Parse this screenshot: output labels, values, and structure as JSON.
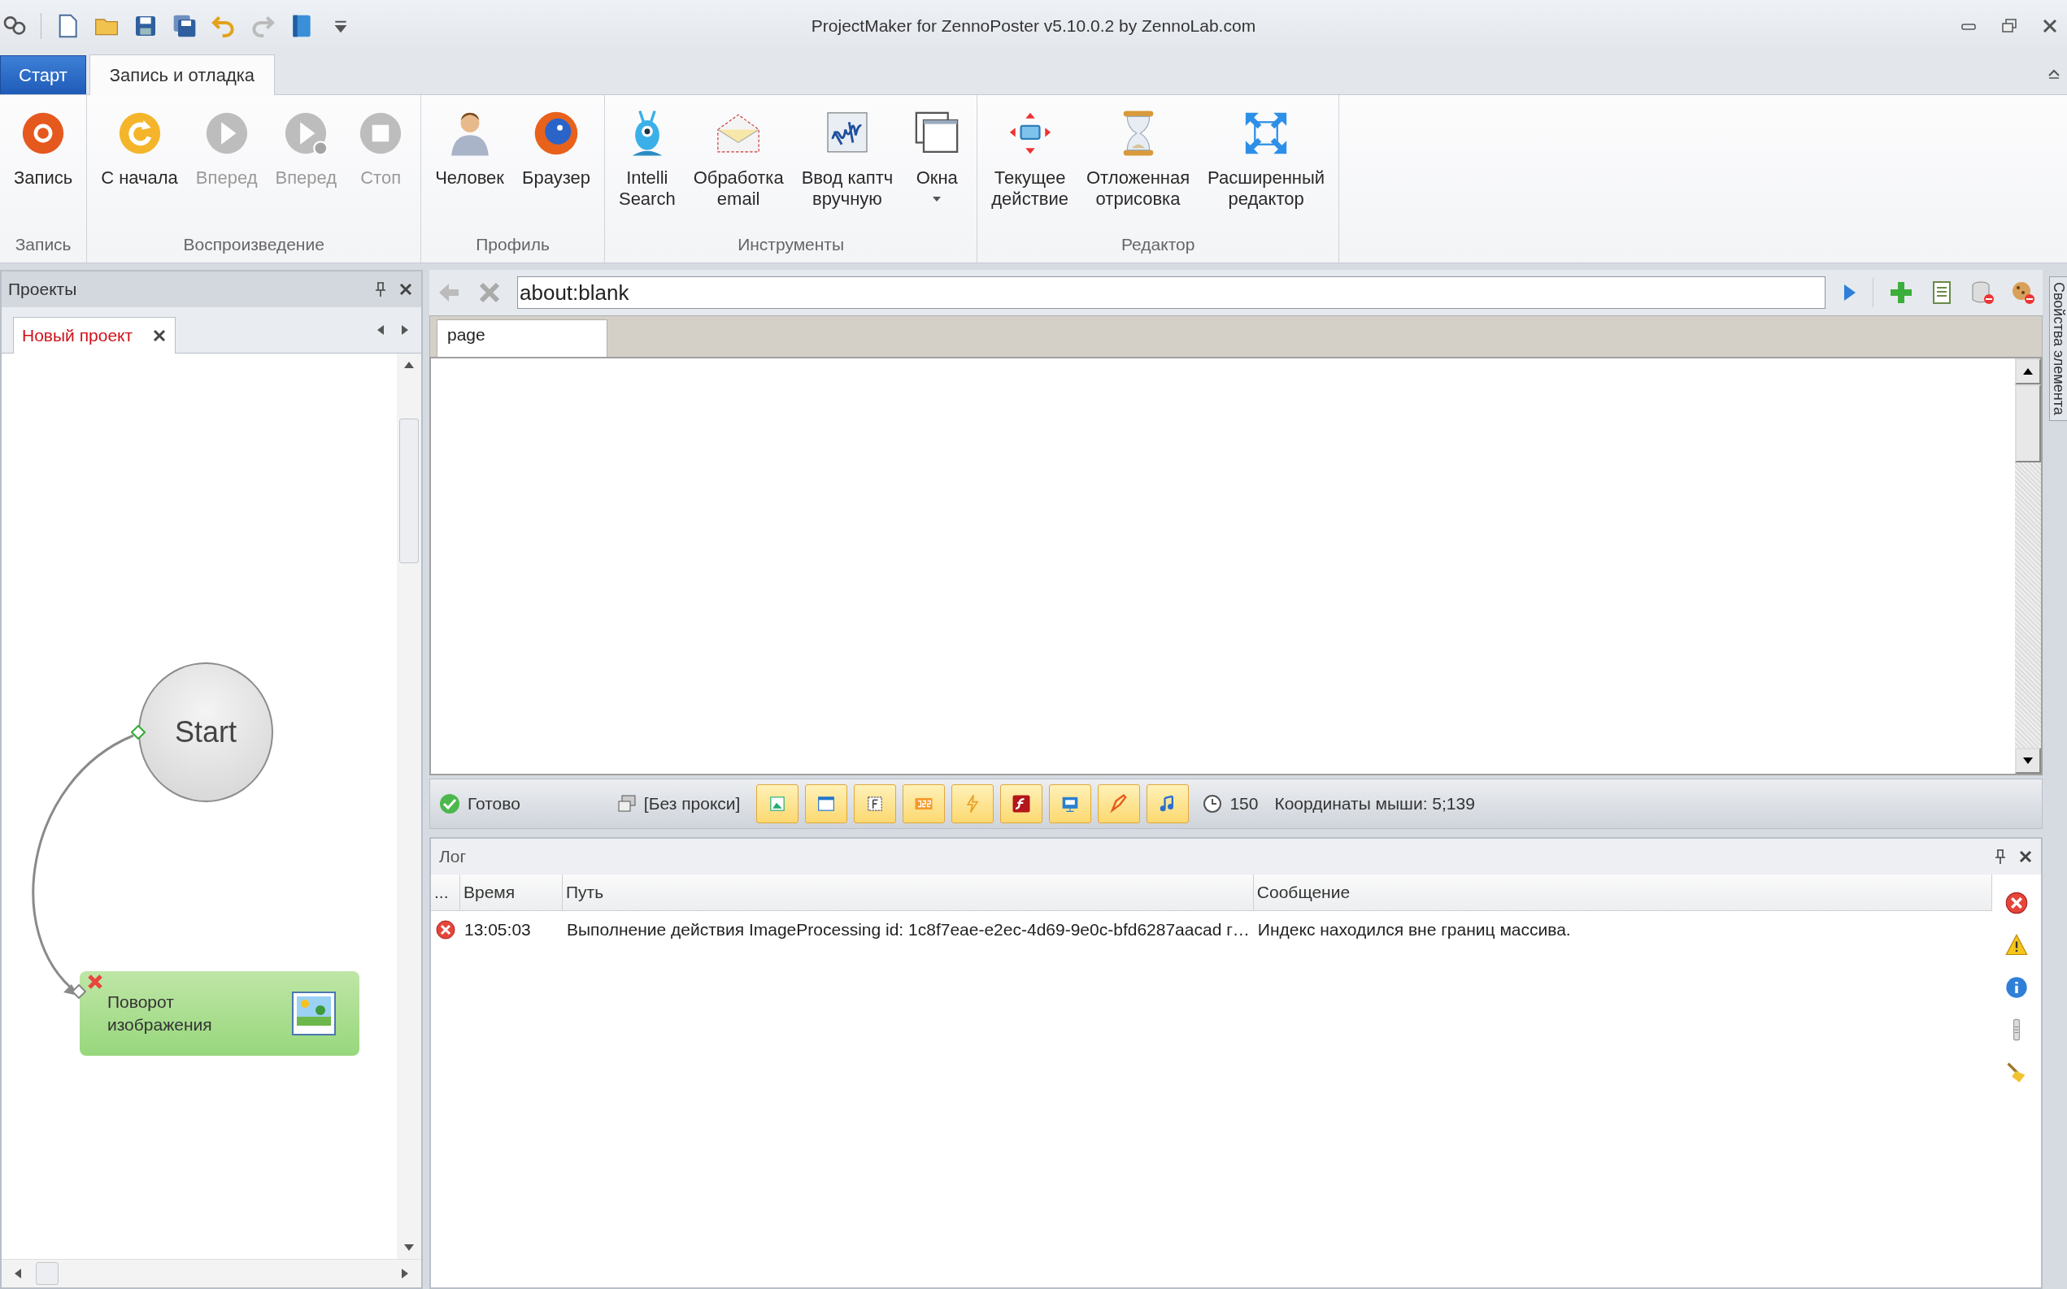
{
  "window": {
    "title": "ProjectMaker for ZennoPoster v5.10.0.2 by ZennoLab.com"
  },
  "ribbon": {
    "tabs": [
      {
        "label": "Старт",
        "kind": "app",
        "selected": false
      },
      {
        "label": "Запись и отладка",
        "kind": "tab",
        "selected": true
      }
    ],
    "groups": [
      {
        "label": "Запись",
        "buttons": [
          {
            "label": "Запись",
            "disabled": false,
            "dropdown": false
          }
        ]
      },
      {
        "label": "Воспроизведение",
        "buttons": [
          {
            "label": "С начала",
            "disabled": false,
            "dropdown": false
          },
          {
            "label": "Вперед",
            "disabled": true,
            "dropdown": false
          },
          {
            "label": "Вперед",
            "disabled": true,
            "dropdown": false
          },
          {
            "label": "Стоп",
            "disabled": true,
            "dropdown": false
          }
        ]
      },
      {
        "label": "Профиль",
        "buttons": [
          {
            "label": "Человек",
            "disabled": false,
            "dropdown": false
          },
          {
            "label": "Браузер",
            "disabled": false,
            "dropdown": false
          }
        ]
      },
      {
        "label": "Инструменты",
        "buttons": [
          {
            "label": "Intelli\nSearch",
            "disabled": false,
            "dropdown": false
          },
          {
            "label": "Обработка\nemail",
            "disabled": false,
            "dropdown": false
          },
          {
            "label": "Ввод каптч\nвручную",
            "disabled": false,
            "dropdown": false
          },
          {
            "label": "Окна",
            "disabled": false,
            "dropdown": true
          }
        ]
      },
      {
        "label": "Редактор",
        "buttons": [
          {
            "label": "Текущее\nдействие",
            "disabled": false,
            "dropdown": false
          },
          {
            "label": "Отложенная\nотрисовка",
            "disabled": false,
            "dropdown": false
          },
          {
            "label": "Расширенный\nредактор",
            "disabled": false,
            "dropdown": false
          }
        ]
      }
    ]
  },
  "projects_panel": {
    "title": "Проекты",
    "tabs": [
      {
        "label": "Новый проект",
        "selected": true
      }
    ],
    "diagram": {
      "start": {
        "label": "Start"
      },
      "actions": [
        {
          "label": "Поворот\nизображения",
          "error": true
        }
      ]
    }
  },
  "browser": {
    "address": "about:blank",
    "tabs": [
      {
        "label": "page",
        "selected": true
      }
    ]
  },
  "status_bar": {
    "status": "Готово",
    "proxy": "[Без прокси]",
    "timeout": "150",
    "mouse_coordinates": "Координаты мыши: 5;139"
  },
  "log": {
    "title": "Лог",
    "columns": [
      "...",
      "Время",
      "Путь",
      "Сообщение"
    ],
    "rows": [
      {
        "kind": "error",
        "time": "13:05:03",
        "path": "Выполнение действия ImageProcessing id: 1c8f7eae-e2ec-4d69-9e0c-bfd6287aacad г…",
        "message": "Индекс находился вне границ массива."
      }
    ]
  },
  "side_panel": {
    "tab": "Свойства элемента"
  }
}
